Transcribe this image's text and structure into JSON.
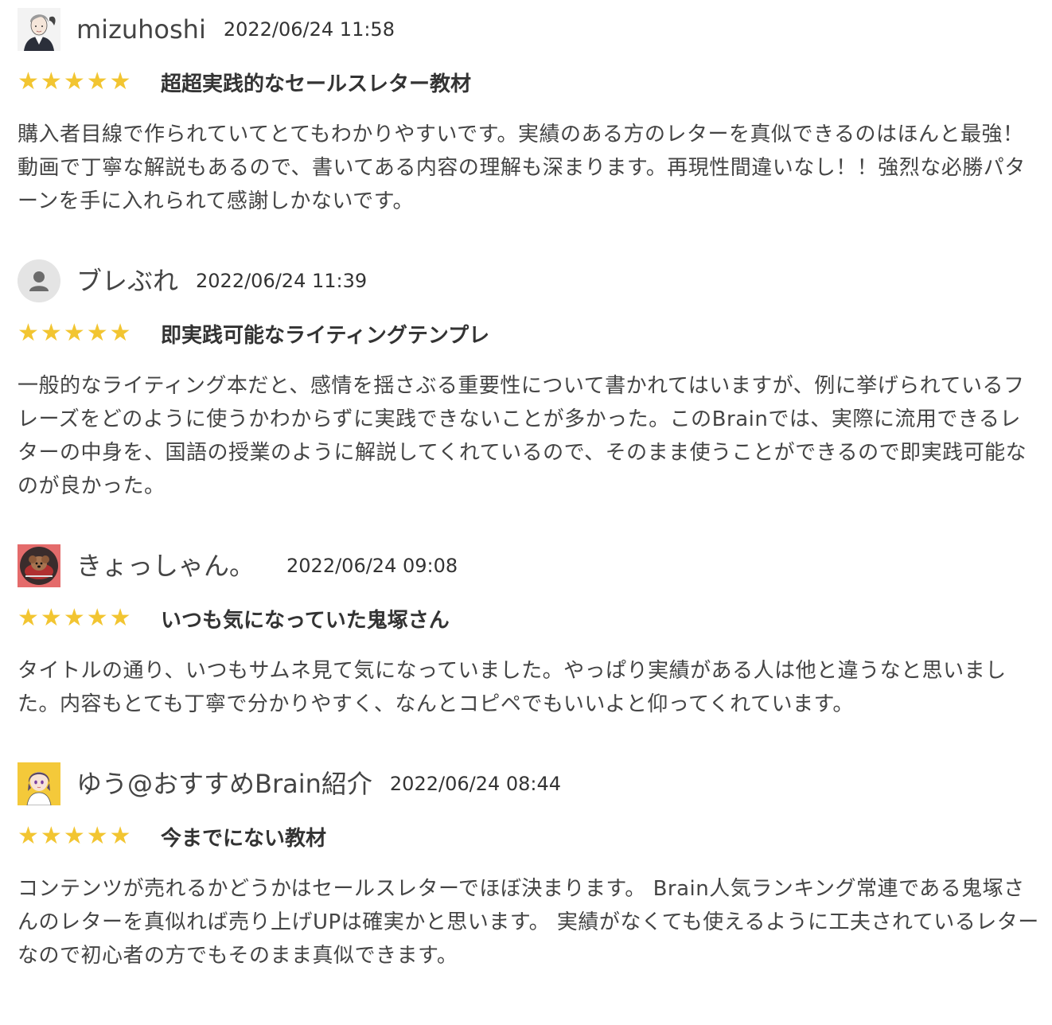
{
  "reviews": [
    {
      "username": "mizuhoshi",
      "date": "2022/06/24 11:58",
      "avatar_icon": "user-avatar-illustration-man",
      "rating": 5,
      "title": "超超実践的なセールスレター教材",
      "body": "購入者目線で作られていてとてもわかりやすいです。実績のある方のレターを真似できるのはほんと最強！動画で丁寧な解説もあるので、書いてある内容の理解も深まります。再現性間違いなし！！強烈な必勝パターンを手に入れられて感謝しかないです。"
    },
    {
      "username": "ブレぶれ",
      "date": "2022/06/24 11:39",
      "avatar_icon": "default-user-icon",
      "rating": 5,
      "title": "即実践可能なライティングテンプレ",
      "body": "一般的なライティング本だと、感情を揺さぶる重要性について書かれてはいますが、例に挙げられているフレーズをどのように使うかわからずに実践できないことが多かった。このBrainでは、実際に流用できるレターの中身を、国語の授業のように解説してくれているので、そのまま使うことができるので即実践可能なのが良かった。"
    },
    {
      "username": "きょっしゃん。",
      "date": "2022/06/24 09:08",
      "avatar_icon": "dog-photo-avatar",
      "rating": 5,
      "title": "いつも気になっていた鬼塚さん",
      "body": "タイトルの通り、いつもサムネ見て気になっていました。やっぱり実績がある人は他と違うなと思いました。内容もとても丁寧で分かりやすく、なんとコピペでもいいよと仰ってくれています。"
    },
    {
      "username": "ゆう@おすすめBrain紹介",
      "date": "2022/06/24 08:44",
      "avatar_icon": "user-avatar-illustration-girl",
      "rating": 5,
      "title": "今までにない教材",
      "body": "コンテンツが売れるかどうかはセールスレターでほぼ決まります。 Brain人気ランキング常連である鬼塚さんのレターを真似れば売り上げUPは確実かと思います。 実績がなくても使えるように工夫されているレターなので初心者の方でもそのまま真似できます。"
    }
  ],
  "colors": {
    "star": "#f2c531",
    "text": "#333333"
  }
}
